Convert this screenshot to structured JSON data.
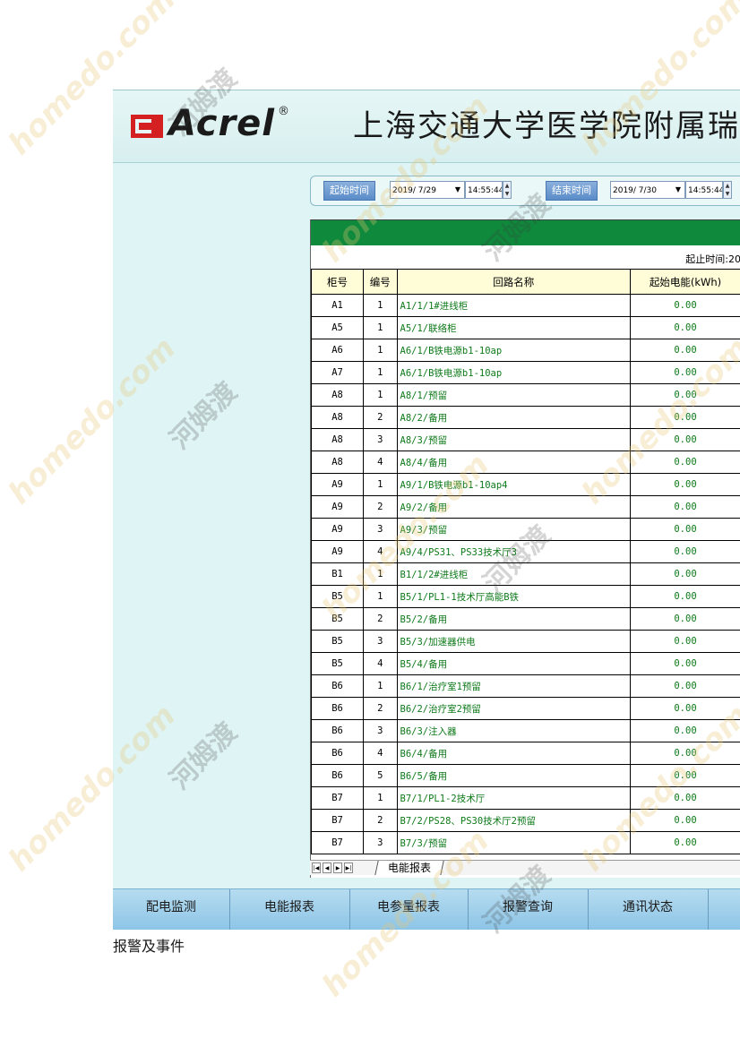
{
  "header": {
    "brand": "Acrel",
    "brand_mark": "®",
    "title": "上海交通大学医学院附属瑞金医"
  },
  "toolbar": {
    "start_label": "起始时间",
    "start_date": "2019/ 7/29",
    "start_time": "14:55:44",
    "end_label": "结束时间",
    "end_date": "2019/ 7/30",
    "end_time": "14:55:44"
  },
  "report": {
    "period_label": "起止时间:20",
    "columns": [
      "柜号",
      "编号",
      "回路名称",
      "起始电能(kWh)"
    ],
    "rows": [
      [
        "A1",
        "1",
        "A1/1/1#进线柜",
        "0.00"
      ],
      [
        "A5",
        "1",
        "A5/1/联络柜",
        "0.00"
      ],
      [
        "A6",
        "1",
        "A6/1/B铁电源b1-10ap",
        "0.00"
      ],
      [
        "A7",
        "1",
        "A6/1/B铁电源b1-10ap",
        "0.00"
      ],
      [
        "A8",
        "1",
        "A8/1/预留",
        "0.00"
      ],
      [
        "A8",
        "2",
        "A8/2/备用",
        "0.00"
      ],
      [
        "A8",
        "3",
        "A8/3/预留",
        "0.00"
      ],
      [
        "A8",
        "4",
        "A8/4/备用",
        "0.00"
      ],
      [
        "A9",
        "1",
        "A9/1/B铁电源b1-10ap4",
        "0.00"
      ],
      [
        "A9",
        "2",
        "A9/2/备用",
        "0.00"
      ],
      [
        "A9",
        "3",
        "A9/3/预留",
        "0.00"
      ],
      [
        "A9",
        "4",
        "A9/4/PS31、PS33技术厅3",
        "0.00"
      ],
      [
        "B1",
        "1",
        "B1/1/2#进线柜",
        "0.00"
      ],
      [
        "B5",
        "1",
        "B5/1/PL1-1技术厅高能B铁",
        "0.00"
      ],
      [
        "B5",
        "2",
        "B5/2/备用",
        "0.00"
      ],
      [
        "B5",
        "3",
        "B5/3/加速器供电",
        "0.00"
      ],
      [
        "B5",
        "4",
        "B5/4/备用",
        "0.00"
      ],
      [
        "B6",
        "1",
        "B6/1/治疗室1预留",
        "0.00"
      ],
      [
        "B6",
        "2",
        "B6/2/治疗室2预留",
        "0.00"
      ],
      [
        "B6",
        "3",
        "B6/3/注入器",
        "0.00"
      ],
      [
        "B6",
        "4",
        "B6/4/备用",
        "0.00"
      ],
      [
        "B6",
        "5",
        "B6/5/备用",
        "0.00"
      ],
      [
        "B7",
        "1",
        "B7/1/PL1-2技术厅",
        "0.00"
      ],
      [
        "B7",
        "2",
        "B7/2/PS28、PS30技术厅2预留",
        "0.00"
      ],
      [
        "B7",
        "3",
        "B7/3/预留",
        "0.00"
      ]
    ],
    "sheet_tab": "电能报表"
  },
  "menu": [
    "配电监测",
    "电能报表",
    "电参量报表",
    "报警查询",
    "通讯状态"
  ],
  "caption": "报警及事件",
  "watermark": [
    "homedo.com",
    "河姆渡"
  ],
  "colors": {
    "band_green": "#0f8a3c",
    "value_green": "#0e7a1a",
    "header_yellow": "#fffcd8",
    "menu_blue": "#8cc4e6"
  }
}
